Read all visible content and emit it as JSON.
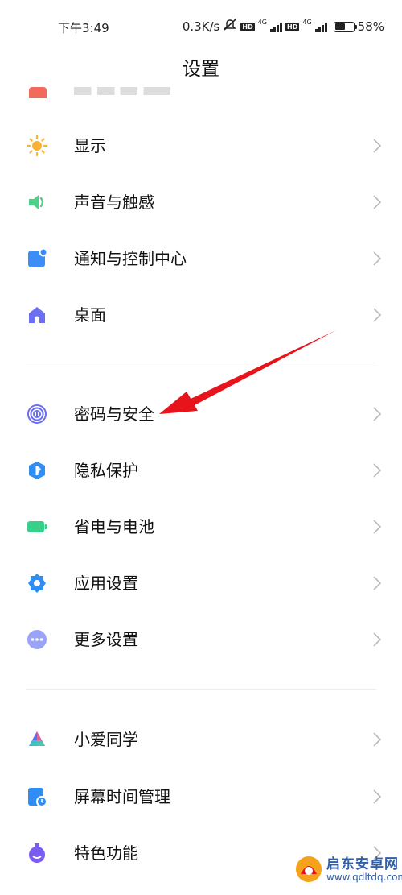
{
  "status_bar": {
    "time": "下午3:49",
    "network_speed": "0.3K/s",
    "network_type_1": "4G",
    "network_type_2": "4G",
    "hd_label_1": "HD",
    "hd_label_2": "HD",
    "battery_level": "58%",
    "battery_fraction": 0.58,
    "icons": [
      "mute-icon",
      "hd-icon",
      "signal-icon",
      "battery-icon"
    ]
  },
  "header": {
    "title": "设置"
  },
  "groups": [
    {
      "items": [
        {
          "label": "显示",
          "icon": "sun-icon",
          "color": "#f9b233"
        },
        {
          "label": "声音与触感",
          "icon": "speaker-icon",
          "color": "#4cd18a"
        },
        {
          "label": "通知与控制中心",
          "icon": "notification-icon",
          "color": "#3a8ef6"
        },
        {
          "label": "桌面",
          "icon": "home-icon",
          "color": "#6b6ff0"
        }
      ]
    },
    {
      "items": [
        {
          "label": "密码与安全",
          "icon": "fingerprint-icon",
          "color": "#6b6ff0"
        },
        {
          "label": "隐私保护",
          "icon": "privacy-shield-icon",
          "color": "#2f8ef4"
        },
        {
          "label": "省电与电池",
          "icon": "battery-icon",
          "color": "#36d08a"
        },
        {
          "label": "应用设置",
          "icon": "gear-icon",
          "color": "#2f8ef4"
        },
        {
          "label": "更多设置",
          "icon": "more-dots-icon",
          "color": "#9aa3f5"
        }
      ]
    },
    {
      "items": [
        {
          "label": "小爱同学",
          "icon": "xiaoai-icon",
          "color": "#5a6ff0"
        },
        {
          "label": "屏幕时间管理",
          "icon": "screen-time-icon",
          "color": "#2f8ef4"
        },
        {
          "label": "特色功能",
          "icon": "special-features-icon",
          "color": "#7b5cf0"
        }
      ]
    }
  ],
  "annotation": {
    "icon": "red-arrow-annotation",
    "color": "#e8141c"
  },
  "watermark": {
    "name": "启东安卓网",
    "url": "www.qdltdq.com",
    "icon": "watermark-logo-icon"
  }
}
